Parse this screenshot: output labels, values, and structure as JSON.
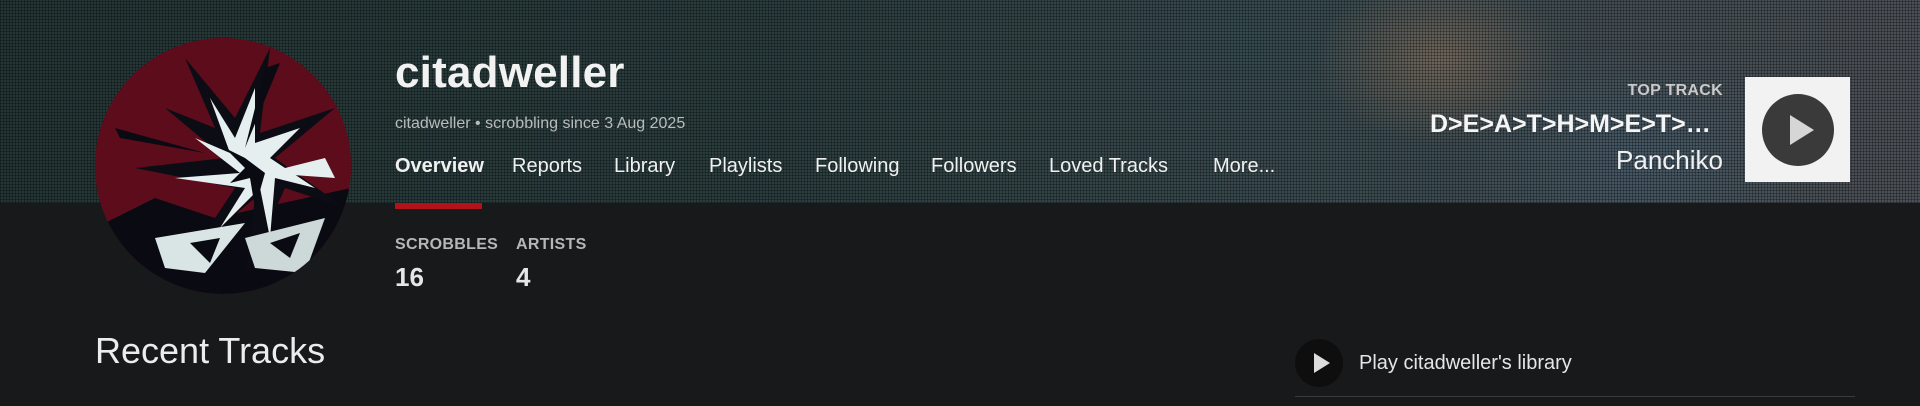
{
  "profile": {
    "username": "citadweller",
    "subline": "citadweller • scrobbling since 3 Aug 2025"
  },
  "nav": {
    "items": [
      {
        "label": "Overview",
        "active": true
      },
      {
        "label": "Reports"
      },
      {
        "label": "Library"
      },
      {
        "label": "Playlists"
      },
      {
        "label": "Following"
      },
      {
        "label": "Followers"
      },
      {
        "label": "Loved Tracks"
      },
      {
        "label": "More..."
      }
    ]
  },
  "stats": {
    "scrobbles_label": "SCROBBLES",
    "scrobbles_value": "16",
    "artists_label": "ARTISTS",
    "artists_value": "4"
  },
  "top_track": {
    "label": "TOP TRACK",
    "name": "D>E>A>T>H>M>E>T>A...",
    "artist": "Panchiko",
    "art_icon": "play-icon"
  },
  "recent": {
    "title": "Recent Tracks"
  },
  "play_library": {
    "label": "Play citadweller's library",
    "icon": "play-icon"
  },
  "colors": {
    "accent": "#b3121b",
    "background": "#18191a"
  }
}
